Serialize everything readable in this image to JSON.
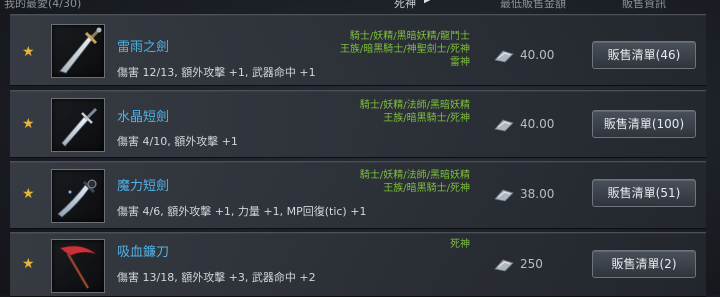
{
  "header": {
    "title": "我的最愛(4/30)",
    "class_filter": "死神",
    "price_col": "最低販售金額",
    "info_col": "販售資訊"
  },
  "items": [
    {
      "name": "雷雨之劍",
      "stats": "傷害 12/13, 額外攻擊 +1, 武器命中 +1",
      "classes": [
        "騎士/妖精/黑暗妖精/龍鬥士",
        "王族/暗黑騎士/神聖劍士/死神",
        "雷神"
      ],
      "price": "40.00",
      "sell_label": "販售清單(46)"
    },
    {
      "name": "水晶短劍",
      "stats": "傷害 4/10, 額外攻擊 +1",
      "classes": [
        "騎士/妖精/法師/黑暗妖精",
        "王族/暗黑騎士/死神"
      ],
      "price": "40.00",
      "sell_label": "販售清單(100)"
    },
    {
      "name": "魔力短劍",
      "stats": "傷害 4/6, 額外攻擊 +1, 力量 +1, MP回復(tic) +1",
      "classes": [
        "騎士/妖精/法師/黑暗妖精",
        "王族/暗黑騎士/死神"
      ],
      "price": "38.00",
      "sell_label": "販售清單(51)"
    },
    {
      "name": "吸血鐮刀",
      "stats": "傷害 13/18, 額外攻擊 +3, 武器命中 +2",
      "classes": [
        "死神"
      ],
      "price": "250",
      "sell_label": "販售清單(2)"
    }
  ]
}
